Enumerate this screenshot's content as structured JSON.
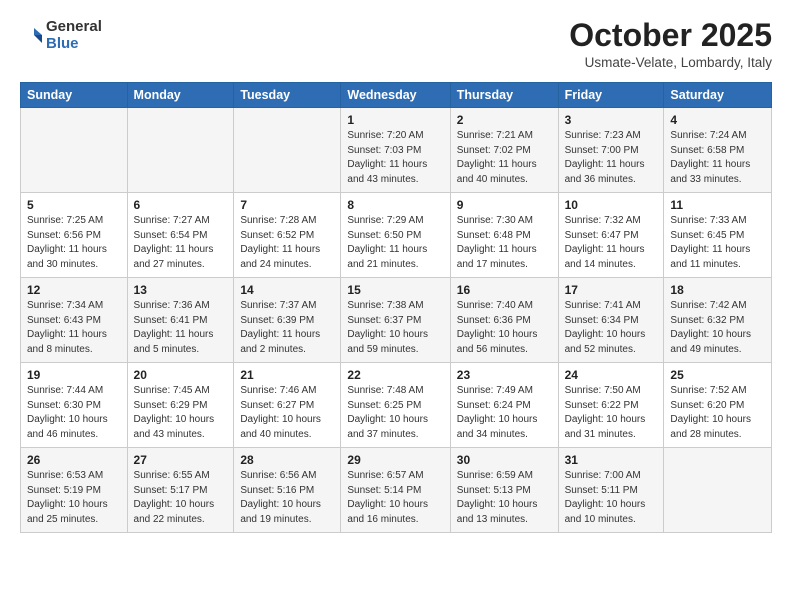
{
  "logo": {
    "general": "General",
    "blue": "Blue"
  },
  "title": "October 2025",
  "subtitle": "Usmate-Velate, Lombardy, Italy",
  "days_of_week": [
    "Sunday",
    "Monday",
    "Tuesday",
    "Wednesday",
    "Thursday",
    "Friday",
    "Saturday"
  ],
  "weeks": [
    [
      {
        "day": "",
        "info": ""
      },
      {
        "day": "",
        "info": ""
      },
      {
        "day": "",
        "info": ""
      },
      {
        "day": "1",
        "info": "Sunrise: 7:20 AM\nSunset: 7:03 PM\nDaylight: 11 hours and 43 minutes."
      },
      {
        "day": "2",
        "info": "Sunrise: 7:21 AM\nSunset: 7:02 PM\nDaylight: 11 hours and 40 minutes."
      },
      {
        "day": "3",
        "info": "Sunrise: 7:23 AM\nSunset: 7:00 PM\nDaylight: 11 hours and 36 minutes."
      },
      {
        "day": "4",
        "info": "Sunrise: 7:24 AM\nSunset: 6:58 PM\nDaylight: 11 hours and 33 minutes."
      }
    ],
    [
      {
        "day": "5",
        "info": "Sunrise: 7:25 AM\nSunset: 6:56 PM\nDaylight: 11 hours and 30 minutes."
      },
      {
        "day": "6",
        "info": "Sunrise: 7:27 AM\nSunset: 6:54 PM\nDaylight: 11 hours and 27 minutes."
      },
      {
        "day": "7",
        "info": "Sunrise: 7:28 AM\nSunset: 6:52 PM\nDaylight: 11 hours and 24 minutes."
      },
      {
        "day": "8",
        "info": "Sunrise: 7:29 AM\nSunset: 6:50 PM\nDaylight: 11 hours and 21 minutes."
      },
      {
        "day": "9",
        "info": "Sunrise: 7:30 AM\nSunset: 6:48 PM\nDaylight: 11 hours and 17 minutes."
      },
      {
        "day": "10",
        "info": "Sunrise: 7:32 AM\nSunset: 6:47 PM\nDaylight: 11 hours and 14 minutes."
      },
      {
        "day": "11",
        "info": "Sunrise: 7:33 AM\nSunset: 6:45 PM\nDaylight: 11 hours and 11 minutes."
      }
    ],
    [
      {
        "day": "12",
        "info": "Sunrise: 7:34 AM\nSunset: 6:43 PM\nDaylight: 11 hours and 8 minutes."
      },
      {
        "day": "13",
        "info": "Sunrise: 7:36 AM\nSunset: 6:41 PM\nDaylight: 11 hours and 5 minutes."
      },
      {
        "day": "14",
        "info": "Sunrise: 7:37 AM\nSunset: 6:39 PM\nDaylight: 11 hours and 2 minutes."
      },
      {
        "day": "15",
        "info": "Sunrise: 7:38 AM\nSunset: 6:37 PM\nDaylight: 10 hours and 59 minutes."
      },
      {
        "day": "16",
        "info": "Sunrise: 7:40 AM\nSunset: 6:36 PM\nDaylight: 10 hours and 56 minutes."
      },
      {
        "day": "17",
        "info": "Sunrise: 7:41 AM\nSunset: 6:34 PM\nDaylight: 10 hours and 52 minutes."
      },
      {
        "day": "18",
        "info": "Sunrise: 7:42 AM\nSunset: 6:32 PM\nDaylight: 10 hours and 49 minutes."
      }
    ],
    [
      {
        "day": "19",
        "info": "Sunrise: 7:44 AM\nSunset: 6:30 PM\nDaylight: 10 hours and 46 minutes."
      },
      {
        "day": "20",
        "info": "Sunrise: 7:45 AM\nSunset: 6:29 PM\nDaylight: 10 hours and 43 minutes."
      },
      {
        "day": "21",
        "info": "Sunrise: 7:46 AM\nSunset: 6:27 PM\nDaylight: 10 hours and 40 minutes."
      },
      {
        "day": "22",
        "info": "Sunrise: 7:48 AM\nSunset: 6:25 PM\nDaylight: 10 hours and 37 minutes."
      },
      {
        "day": "23",
        "info": "Sunrise: 7:49 AM\nSunset: 6:24 PM\nDaylight: 10 hours and 34 minutes."
      },
      {
        "day": "24",
        "info": "Sunrise: 7:50 AM\nSunset: 6:22 PM\nDaylight: 10 hours and 31 minutes."
      },
      {
        "day": "25",
        "info": "Sunrise: 7:52 AM\nSunset: 6:20 PM\nDaylight: 10 hours and 28 minutes."
      }
    ],
    [
      {
        "day": "26",
        "info": "Sunrise: 6:53 AM\nSunset: 5:19 PM\nDaylight: 10 hours and 25 minutes."
      },
      {
        "day": "27",
        "info": "Sunrise: 6:55 AM\nSunset: 5:17 PM\nDaylight: 10 hours and 22 minutes."
      },
      {
        "day": "28",
        "info": "Sunrise: 6:56 AM\nSunset: 5:16 PM\nDaylight: 10 hours and 19 minutes."
      },
      {
        "day": "29",
        "info": "Sunrise: 6:57 AM\nSunset: 5:14 PM\nDaylight: 10 hours and 16 minutes."
      },
      {
        "day": "30",
        "info": "Sunrise: 6:59 AM\nSunset: 5:13 PM\nDaylight: 10 hours and 13 minutes."
      },
      {
        "day": "31",
        "info": "Sunrise: 7:00 AM\nSunset: 5:11 PM\nDaylight: 10 hours and 10 minutes."
      },
      {
        "day": "",
        "info": ""
      }
    ]
  ]
}
